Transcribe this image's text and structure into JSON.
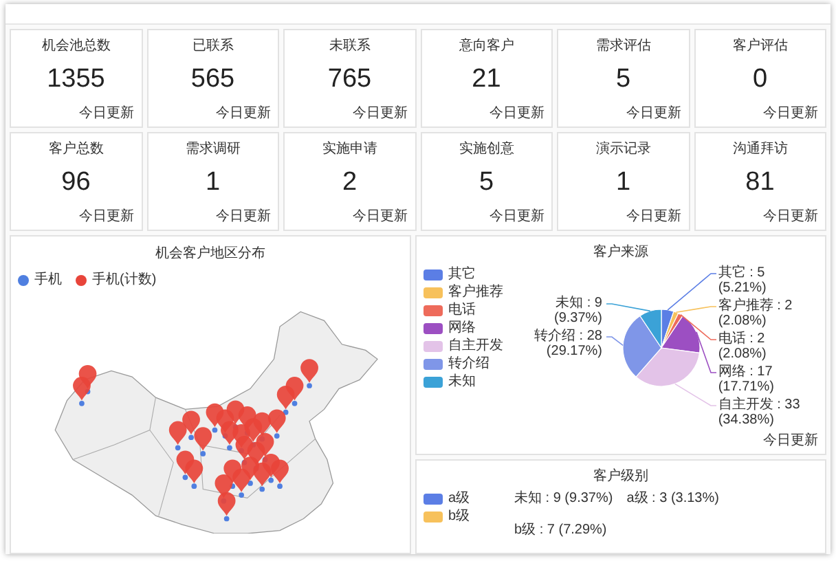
{
  "cards": [
    {
      "title": "机会池总数",
      "value": "1355",
      "footer": "今日更新"
    },
    {
      "title": "已联系",
      "value": "565",
      "footer": "今日更新"
    },
    {
      "title": "未联系",
      "value": "765",
      "footer": "今日更新"
    },
    {
      "title": "意向客户",
      "value": "21",
      "footer": "今日更新"
    },
    {
      "title": "需求评估",
      "value": "5",
      "footer": "今日更新"
    },
    {
      "title": "客户评估",
      "value": "0",
      "footer": "今日更新"
    },
    {
      "title": "客户总数",
      "value": "96",
      "footer": "今日更新"
    },
    {
      "title": "需求调研",
      "value": "1",
      "footer": "今日更新"
    },
    {
      "title": "实施申请",
      "value": "2",
      "footer": "今日更新"
    },
    {
      "title": "实施创意",
      "value": "5",
      "footer": "今日更新"
    },
    {
      "title": "演示记录",
      "value": "1",
      "footer": "今日更新"
    },
    {
      "title": "沟通拜访",
      "value": "81",
      "footer": "今日更新"
    }
  ],
  "map_panel": {
    "title": "机会客户地区分布",
    "legend": [
      {
        "label": "手机",
        "color": "#4f7fe0"
      },
      {
        "label": "手机(计数)",
        "color": "#e8443a"
      }
    ]
  },
  "source_panel": {
    "footer": "今日更新",
    "chart_data": {
      "type": "pie",
      "title": "客户来源",
      "categories": [
        "其它",
        "客户推荐",
        "电话",
        "网络",
        "自主开发",
        "转介绍",
        "未知"
      ],
      "colors": [
        "#5b7ee5",
        "#f7c15b",
        "#ee6b5b",
        "#9c4fc2",
        "#e3c3e8",
        "#7f96e8",
        "#3ba2d7"
      ],
      "values": [
        5,
        2,
        2,
        17,
        33,
        28,
        9
      ],
      "value_labels": [
        "其它 : 5 (5.21%)",
        "客户推荐 : 2 (2.08%)",
        "电话 : 2 (2.08%)",
        "网络 : 17 (17.71%)",
        "自主开发 : 33 (34.38%)",
        "转介绍 : 28 (29.17%)",
        "未知 : 9 (9.37%)"
      ]
    }
  },
  "level_panel": {
    "title": "客户级别",
    "legend": [
      {
        "label": "a级",
        "color": "#5b7ee5"
      },
      {
        "label": "b级",
        "color": "#f7c15b"
      }
    ],
    "slice_labels": [
      "未知 : 9 (9.37%)",
      "a级 : 3 (3.13%)",
      "b级 : 7 (7.29%)"
    ]
  }
}
